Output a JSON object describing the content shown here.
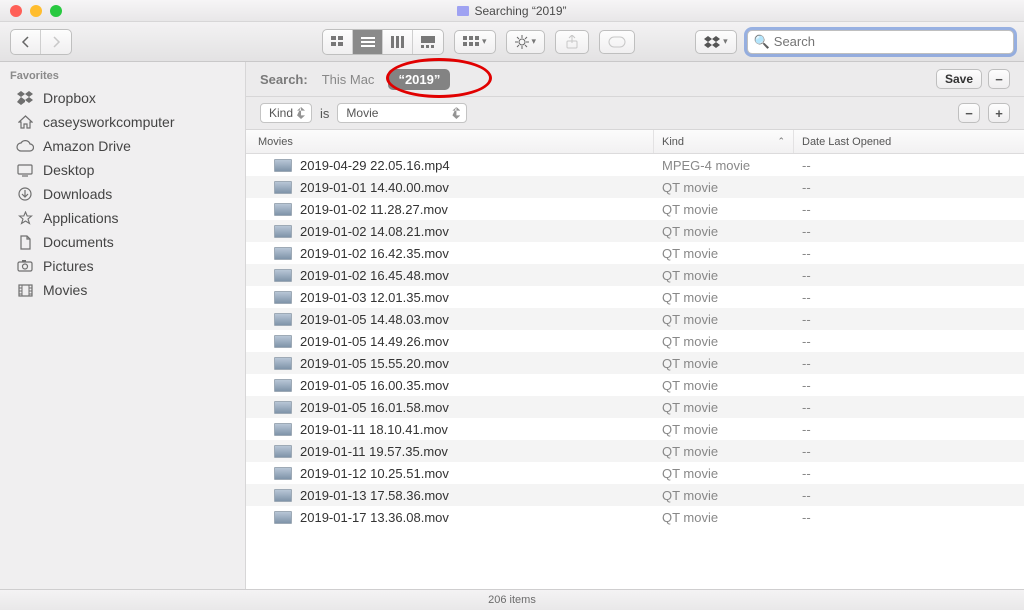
{
  "window": {
    "title": "Searching “2019”"
  },
  "search": {
    "placeholder": "Search",
    "value": ""
  },
  "sidebar": {
    "section": "Favorites",
    "items": [
      {
        "icon": "dropbox-icon",
        "label": "Dropbox"
      },
      {
        "icon": "home-icon",
        "label": "caseysworkcomputer"
      },
      {
        "icon": "cloud-icon",
        "label": "Amazon Drive"
      },
      {
        "icon": "desktop-icon",
        "label": "Desktop"
      },
      {
        "icon": "download-icon",
        "label": "Downloads"
      },
      {
        "icon": "apps-icon",
        "label": "Applications"
      },
      {
        "icon": "doc-icon",
        "label": "Documents"
      },
      {
        "icon": "camera-icon",
        "label": "Pictures"
      },
      {
        "icon": "film-icon",
        "label": "Movies"
      }
    ]
  },
  "scope": {
    "label": "Search:",
    "option_this_mac": "This Mac",
    "token": "“2019”",
    "save": "Save"
  },
  "criteria": {
    "field_label": "Kind",
    "operator": "is",
    "value": "Movie"
  },
  "columns": {
    "movies": "Movies",
    "kind": "Kind",
    "date": "Date Last Opened"
  },
  "files": [
    {
      "name": "2019-04-29 22.05.16.mp4",
      "kind": "MPEG-4 movie",
      "date": "--"
    },
    {
      "name": "2019-01-01 14.40.00.mov",
      "kind": "QT movie",
      "date": "--"
    },
    {
      "name": "2019-01-02 11.28.27.mov",
      "kind": "QT movie",
      "date": "--"
    },
    {
      "name": "2019-01-02 14.08.21.mov",
      "kind": "QT movie",
      "date": "--"
    },
    {
      "name": "2019-01-02 16.42.35.mov",
      "kind": "QT movie",
      "date": "--"
    },
    {
      "name": "2019-01-02 16.45.48.mov",
      "kind": "QT movie",
      "date": "--"
    },
    {
      "name": "2019-01-03 12.01.35.mov",
      "kind": "QT movie",
      "date": "--"
    },
    {
      "name": "2019-01-05 14.48.03.mov",
      "kind": "QT movie",
      "date": "--"
    },
    {
      "name": "2019-01-05 14.49.26.mov",
      "kind": "QT movie",
      "date": "--"
    },
    {
      "name": "2019-01-05 15.55.20.mov",
      "kind": "QT movie",
      "date": "--"
    },
    {
      "name": "2019-01-05 16.00.35.mov",
      "kind": "QT movie",
      "date": "--"
    },
    {
      "name": "2019-01-05 16.01.58.mov",
      "kind": "QT movie",
      "date": "--"
    },
    {
      "name": "2019-01-11 18.10.41.mov",
      "kind": "QT movie",
      "date": "--"
    },
    {
      "name": "2019-01-11 19.57.35.mov",
      "kind": "QT movie",
      "date": "--"
    },
    {
      "name": "2019-01-12 10.25.51.mov",
      "kind": "QT movie",
      "date": "--"
    },
    {
      "name": "2019-01-13 17.58.36.mov",
      "kind": "QT movie",
      "date": "--"
    },
    {
      "name": "2019-01-17 13.36.08.mov",
      "kind": "QT movie",
      "date": "--"
    }
  ],
  "status": {
    "count": "206 items"
  }
}
